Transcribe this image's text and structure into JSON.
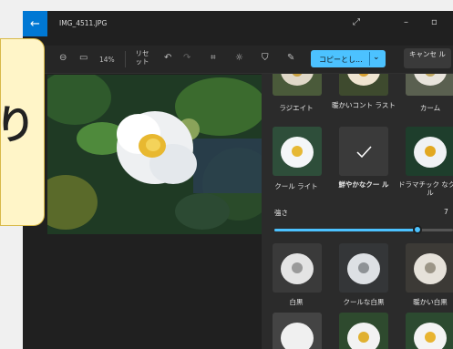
{
  "window": {
    "title": "IMG_4511.JPG"
  },
  "colors": {
    "accent": "#4cc2ff",
    "back_button": "#0078d4",
    "overlay": "#fff5c8"
  },
  "toolbar": {
    "zoom": "14%",
    "reset_label": "リセ ット",
    "copy_label": "コピーとし...",
    "cancel_label": "キャンセ ル"
  },
  "filters": {
    "row0": [
      {
        "label": "ラジエイト"
      },
      {
        "label": "暖かいコント ラスト"
      },
      {
        "label": "カーム"
      }
    ],
    "row1": [
      {
        "label": "クール ライト"
      },
      {
        "label": "鮮やかなクー ル",
        "selected": true
      },
      {
        "label": "ドラマチック なクール"
      }
    ],
    "row2": [
      {
        "label": "白黒"
      },
      {
        "label": "クールな白黒"
      },
      {
        "label": "暖かい白黒"
      }
    ]
  },
  "intensity": {
    "label": "強さ",
    "value": "7",
    "fraction": 0.8
  },
  "overlay": {
    "text": "り"
  }
}
